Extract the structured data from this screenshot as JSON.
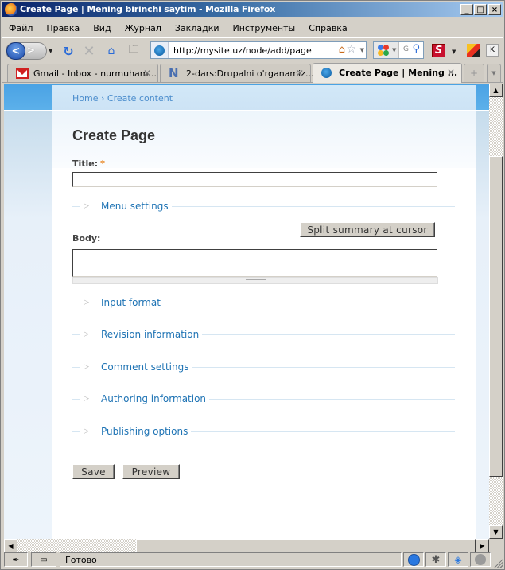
{
  "window": {
    "title": "Create Page | Mening birinchi saytim - Mozilla Firefox",
    "controls": {
      "minimize": "_",
      "maximize": "□",
      "close": "×"
    }
  },
  "menu": [
    "Файл",
    "Правка",
    "Вид",
    "Журнал",
    "Закладки",
    "Инструменты",
    "Справка"
  ],
  "toolbar": {
    "url": "http://mysite.uz/node/add/page",
    "search_engine_hint": "G",
    "icons": [
      "back-icon",
      "forward-icon",
      "history-dropdown-icon",
      "reload-icon",
      "stop-icon",
      "home-icon",
      "new-tab-icon",
      "site-identity-icon",
      "homepage-icon",
      "bookmark-star-icon",
      "google-icon",
      "search-icon",
      "s-addon-icon",
      "k-addon-icon",
      "k-button-icon"
    ]
  },
  "tabs": [
    {
      "label": "Gmail - Inbox - nurmuham...",
      "icon": "gmail-icon",
      "active": false
    },
    {
      "label": "2-dars:Drupalni o'rganamiz...",
      "icon": "n-icon",
      "active": false
    },
    {
      "label": "Create Page | Mening ...",
      "icon": "drupal-icon",
      "active": true
    }
  ],
  "page": {
    "breadcrumb": {
      "home": "Home",
      "separator": "›",
      "current": "Create content"
    },
    "title": "Create Page",
    "form": {
      "title_label": "Title:",
      "required_marker": "*",
      "title_value": "",
      "body_label": "Body:",
      "body_value": "",
      "split_button": "Split summary at cursor",
      "fieldsets": [
        "Menu settings",
        "Input format",
        "Revision information",
        "Comment settings",
        "Authoring information",
        "Publishing options"
      ],
      "save_button": "Save",
      "preview_button": "Preview"
    }
  },
  "status": {
    "text": "Готово"
  }
}
